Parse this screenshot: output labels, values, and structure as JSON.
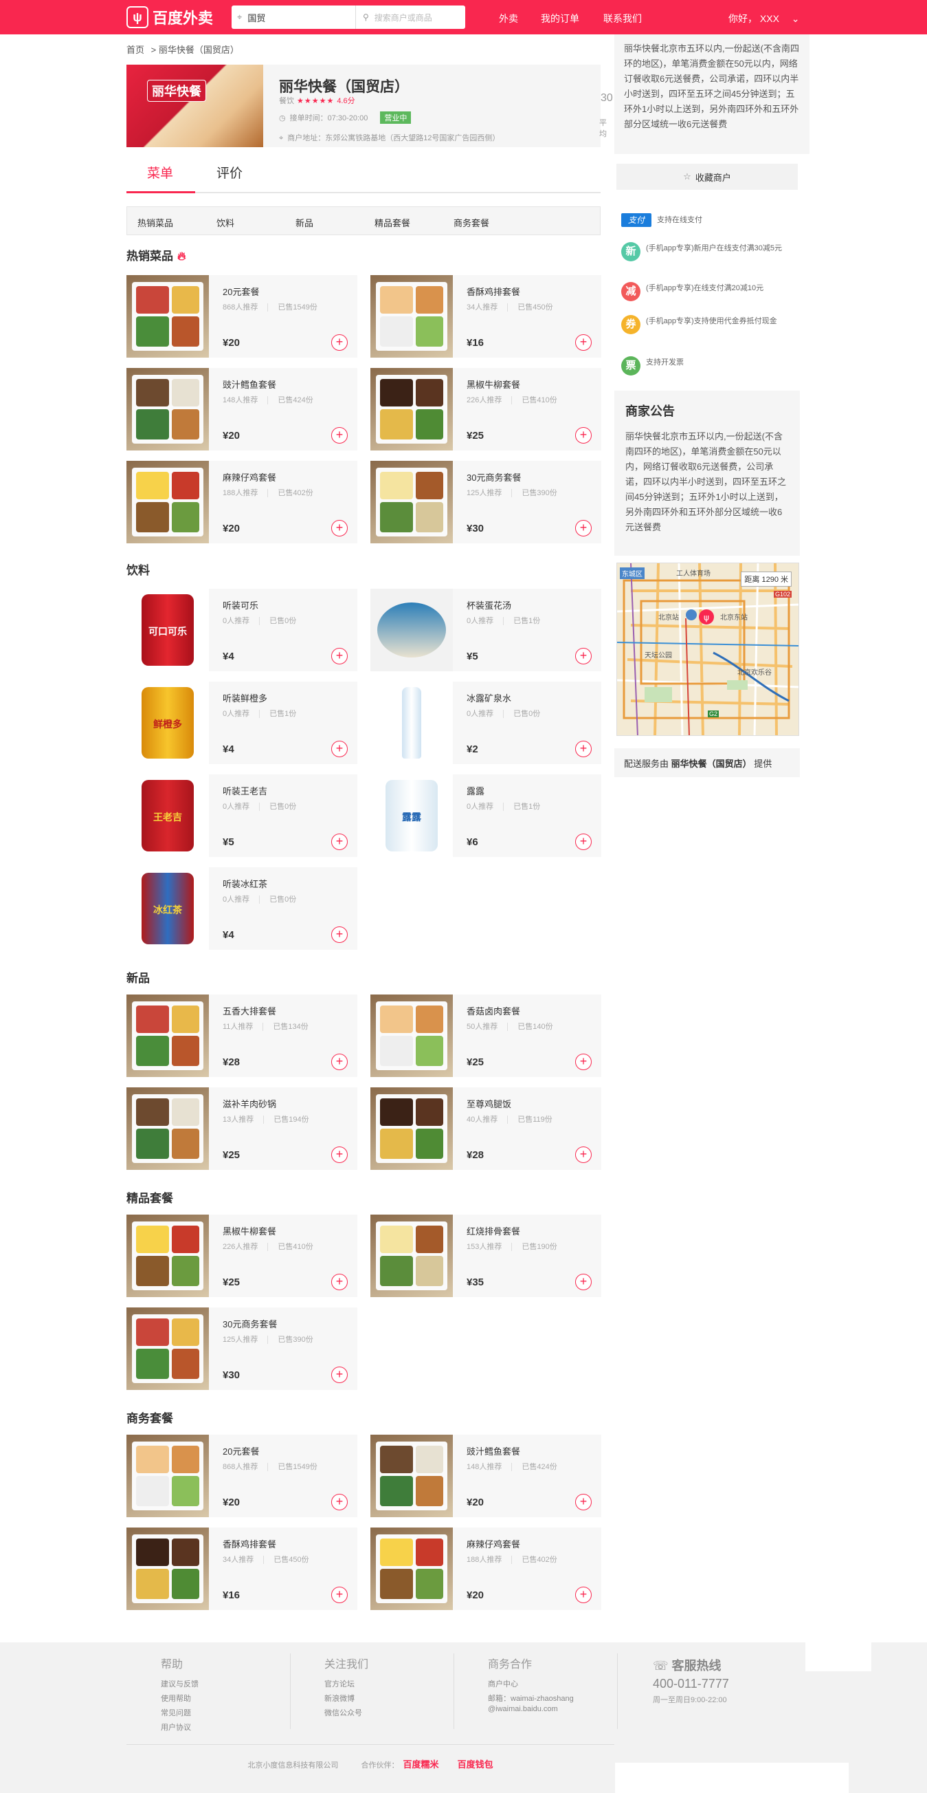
{
  "header": {
    "logo": "百度外卖",
    "location": "国贸",
    "search_placeholder": "搜索商户或商品",
    "nav": [
      "外卖",
      "我的订单",
      "联系我们"
    ],
    "greeting": "你好，  XXX"
  },
  "breadcrumb": {
    "home": "首页",
    "current": "> 丽华快餐（国贸店）"
  },
  "shop": {
    "image_text": "丽华快餐",
    "name": "丽华快餐（国贸店）",
    "category": "餐饮",
    "stars": "★★★★★",
    "score": "4.6分",
    "hours": "接单时间：07:30-20:00",
    "status": "营业中",
    "address": "商户地址：东郊公寓铁路基地（西大望路12号国家广告园西侧）",
    "extra_value": "30",
    "extra_label": "平均"
  },
  "tabs": {
    "menu": "菜单",
    "review": "评价"
  },
  "categories": [
    "热销菜品",
    "饮料",
    "新品",
    "精品套餐",
    "商务套餐"
  ],
  "sections": {
    "hot": {
      "title": "热销菜品",
      "items": [
        {
          "name": "20元套餐",
          "rec": "868人推荐",
          "sold": "已售1549份",
          "price": "¥20"
        },
        {
          "name": "香酥鸡排套餐",
          "rec": "34人推荐",
          "sold": "已售450份",
          "price": "¥16"
        },
        {
          "name": "豉汁鳕鱼套餐",
          "rec": "148人推荐",
          "sold": "已售424份",
          "price": "¥20"
        },
        {
          "name": "黑椒牛柳套餐",
          "rec": "226人推荐",
          "sold": "已售410份",
          "price": "¥25"
        },
        {
          "name": "麻辣仔鸡套餐",
          "rec": "188人推荐",
          "sold": "已售402份",
          "price": "¥20"
        },
        {
          "name": "30元商务套餐",
          "rec": "125人推荐",
          "sold": "已售390份",
          "price": "¥30"
        }
      ]
    },
    "drinks": {
      "title": "饮料",
      "items": [
        {
          "name": "听装可乐",
          "rec": "0人推荐",
          "sold": "已售0份",
          "price": "¥4",
          "label": "可口可乐"
        },
        {
          "name": "杯装蛋花汤",
          "rec": "0人推荐",
          "sold": "已售1份",
          "price": "¥5",
          "label": ""
        },
        {
          "name": "听装鲜橙多",
          "rec": "0人推荐",
          "sold": "已售1份",
          "price": "¥4",
          "label": "鲜橙多"
        },
        {
          "name": "冰露矿泉水",
          "rec": "0人推荐",
          "sold": "已售0份",
          "price": "¥2",
          "label": ""
        },
        {
          "name": "听装王老吉",
          "rec": "0人推荐",
          "sold": "已售0份",
          "price": "¥5",
          "label": "王老吉"
        },
        {
          "name": "露露",
          "rec": "0人推荐",
          "sold": "已售1份",
          "price": "¥6",
          "label": "露露"
        },
        {
          "name": "听装冰红茶",
          "rec": "0人推荐",
          "sold": "已售0份",
          "price": "¥4",
          "label": "冰红茶"
        }
      ]
    },
    "new": {
      "title": "新品",
      "items": [
        {
          "name": "五香大排套餐",
          "rec": "11人推荐",
          "sold": "已售134份",
          "price": "¥28"
        },
        {
          "name": "香菇卤肉套餐",
          "rec": "50人推荐",
          "sold": "已售140份",
          "price": "¥25"
        },
        {
          "name": "滋补羊肉砂锅",
          "rec": "13人推荐",
          "sold": "已售194份",
          "price": "¥25"
        },
        {
          "name": "至尊鸡腿饭",
          "rec": "40人推荐",
          "sold": "已售119份",
          "price": "¥28"
        }
      ]
    },
    "premium": {
      "title": "精品套餐",
      "items": [
        {
          "name": "黑椒牛柳套餐",
          "rec": "226人推荐",
          "sold": "已售410份",
          "price": "¥25"
        },
        {
          "name": "红烧排骨套餐",
          "rec": "153人推荐",
          "sold": "已售190份",
          "price": "¥35"
        },
        {
          "name": "30元商务套餐",
          "rec": "125人推荐",
          "sold": "已售390份",
          "price": "¥30"
        }
      ]
    },
    "business": {
      "title": "商务套餐",
      "items": [
        {
          "name": "20元套餐",
          "rec": "868人推荐",
          "sold": "已售1549份",
          "price": "¥20"
        },
        {
          "name": "豉汁鳕鱼套餐",
          "rec": "148人推荐",
          "sold": "已售424份",
          "price": "¥20"
        },
        {
          "name": "香酥鸡排套餐",
          "rec": "34人推荐",
          "sold": "已售450份",
          "price": "¥16"
        },
        {
          "name": "麻辣仔鸡套餐",
          "rec": "188人推荐",
          "sold": "已售402份",
          "price": "¥20"
        }
      ]
    }
  },
  "sidebar": {
    "desc": "丽华快餐北京市五环以内,一份起送(不含南四环的地区)，单笔消费金额在50元以内，网络订餐收取6元送餐费，公司承诺，四环以内半小时送到，四环至五环之间45分钟送到；五环外1小时以上送到，另外南四环外和五环外部分区域统一收6元送餐费",
    "fav": "收藏商户",
    "promos": [
      {
        "badge": "支付",
        "text": "支持在线支付",
        "color": "#1a7ddc"
      },
      {
        "badge": "新",
        "text": "(手机app专享)新用户在线支付满30减5元",
        "color": "#55c9a6"
      },
      {
        "badge": "减",
        "text": "(手机app专享)在线支付满20减10元",
        "color": "#f25a5a"
      },
      {
        "badge": "券",
        "text": "(手机app专享)支持使用代金券抵付现金",
        "color": "#f5b32b"
      },
      {
        "badge": "票",
        "text": "支持开发票",
        "color": "#5bb55a"
      }
    ],
    "notice_title": "商家公告",
    "notice": "丽华快餐北京市五环以内,一份起送(不含南四环的地区)，单笔消费金额在50元以内，网络订餐收取6元送餐费，公司承诺，四环以内半小时送到，四环至五环之间45分钟送到；五环外1小时以上送到，另外南四环外和五环外部分区域统一收6元送餐费",
    "map": {
      "district": "东城区",
      "distance": "距离 1290 米",
      "labels": [
        "工人体育场",
        "北京站",
        "北京东站",
        "天坛公园",
        "北京欢乐谷",
        "G102",
        "G2"
      ]
    },
    "delivery_pre": "配送服务由 ",
    "delivery_shop": "丽华快餐（国贸店）",
    "delivery_post": " 提供"
  },
  "footer": {
    "cols": [
      {
        "title": "帮助",
        "items": [
          "建议与反馈",
          "使用帮助",
          "常见问题",
          "用户协议"
        ]
      },
      {
        "title": "关注我们",
        "items": [
          "官方论坛",
          "新浪微博",
          "微信公众号"
        ]
      },
      {
        "title": "商务合作",
        "items": [
          "商户中心",
          "邮箱：waimai-zhaoshang",
          "@iwaimai.baidu.com"
        ]
      }
    ],
    "hotline_title": "客服热线",
    "hotline": "400-011-7777",
    "hotline_hours": "周一至周日9:00-22:00",
    "company": "北京小度信息科技有限公司",
    "partner_label": "合作伙伴：",
    "partner1": "百度糯米",
    "partner2": "百度钱包"
  }
}
